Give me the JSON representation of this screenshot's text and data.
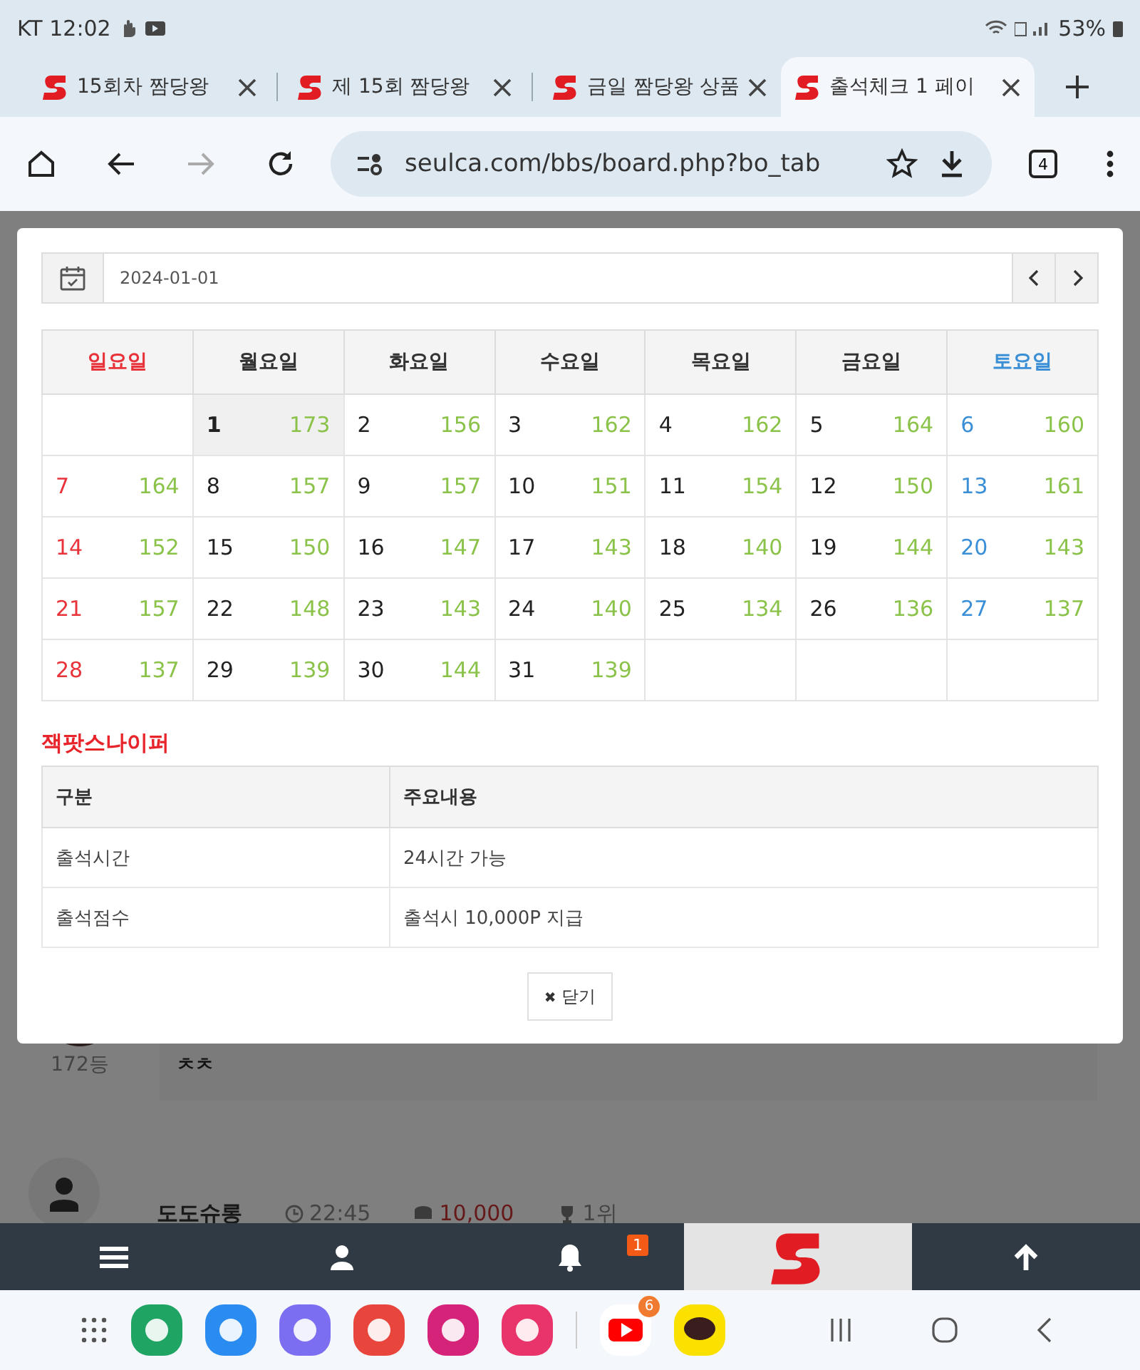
{
  "status_bar": {
    "carrier": "KT",
    "time": "12:02",
    "battery": "53%"
  },
  "browser_tabs": [
    {
      "title": "15회차 짬당왕",
      "selected": false
    },
    {
      "title": "제 15회 짬당왕",
      "selected": false
    },
    {
      "title": "금일 짬당왕 상품",
      "selected": false
    },
    {
      "title": "출석체크 1 페이",
      "selected": true
    }
  ],
  "address_bar": {
    "url": "seulca.com/bbs/board.php?bo_tab",
    "tab_count": "4"
  },
  "background_page": {
    "rank": "172등",
    "comment": "ㅊㅊ",
    "next_post": {
      "author": "도도슈롱",
      "time": "22:45",
      "points": "10,000",
      "rank": "1위"
    }
  },
  "calendar": {
    "date": "2024-01-01",
    "weekdays": [
      {
        "label": "일요일",
        "kind": "sunday"
      },
      {
        "label": "월요일",
        "kind": "weekday"
      },
      {
        "label": "화요일",
        "kind": "weekday"
      },
      {
        "label": "수요일",
        "kind": "weekday"
      },
      {
        "label": "목요일",
        "kind": "weekday"
      },
      {
        "label": "금요일",
        "kind": "weekday"
      },
      {
        "label": "토요일",
        "kind": "saturday"
      }
    ],
    "weeks": [
      [
        {
          "kind": "blank"
        },
        {
          "day": "1",
          "count": "173",
          "selected": true
        },
        {
          "day": "2",
          "count": "156",
          "selected": false
        },
        {
          "day": "3",
          "count": "162",
          "selected": false
        },
        {
          "day": "4",
          "count": "162",
          "selected": false
        },
        {
          "day": "5",
          "count": "164",
          "selected": false
        },
        {
          "day": "6",
          "count": "160",
          "selected": false
        }
      ],
      [
        {
          "day": "7",
          "count": "164",
          "selected": false
        },
        {
          "day": "8",
          "count": "157",
          "selected": false
        },
        {
          "day": "9",
          "count": "157",
          "selected": false
        },
        {
          "day": "10",
          "count": "151",
          "selected": false
        },
        {
          "day": "11",
          "count": "154",
          "selected": false
        },
        {
          "day": "12",
          "count": "150",
          "selected": false
        },
        {
          "day": "13",
          "count": "161",
          "selected": false
        }
      ],
      [
        {
          "day": "14",
          "count": "152",
          "selected": false
        },
        {
          "day": "15",
          "count": "150",
          "selected": false
        },
        {
          "day": "16",
          "count": "147",
          "selected": false
        },
        {
          "day": "17",
          "count": "143",
          "selected": false
        },
        {
          "day": "18",
          "count": "140",
          "selected": false
        },
        {
          "day": "19",
          "count": "144",
          "selected": false
        },
        {
          "day": "20",
          "count": "143",
          "selected": false
        }
      ],
      [
        {
          "day": "21",
          "count": "157",
          "selected": false
        },
        {
          "day": "22",
          "count": "148",
          "selected": false
        },
        {
          "day": "23",
          "count": "143",
          "selected": false
        },
        {
          "day": "24",
          "count": "140",
          "selected": false
        },
        {
          "day": "25",
          "count": "134",
          "selected": false
        },
        {
          "day": "26",
          "count": "136",
          "selected": false
        },
        {
          "day": "27",
          "count": "137",
          "selected": false
        }
      ],
      [
        {
          "day": "28",
          "count": "137",
          "selected": false
        },
        {
          "day": "29",
          "count": "139",
          "selected": false
        },
        {
          "day": "30",
          "count": "144",
          "selected": false
        },
        {
          "day": "31",
          "count": "139",
          "selected": false
        },
        {
          "kind": "blank"
        },
        {
          "kind": "blank"
        },
        {
          "kind": "blank"
        }
      ]
    ]
  },
  "section_title": "잭팟스나이퍼",
  "info_table": {
    "columns": [
      "구분",
      "주요내용"
    ],
    "rows": [
      [
        "출석시간",
        "24시간 가능"
      ],
      [
        "출석점수",
        "출석시 10,000P 지급"
      ]
    ]
  },
  "close_button": {
    "icon": "✖",
    "label": "닫기"
  },
  "bottom_nav": {
    "notification_badge": "1"
  },
  "dock": {
    "youtube_badge": "6"
  }
}
